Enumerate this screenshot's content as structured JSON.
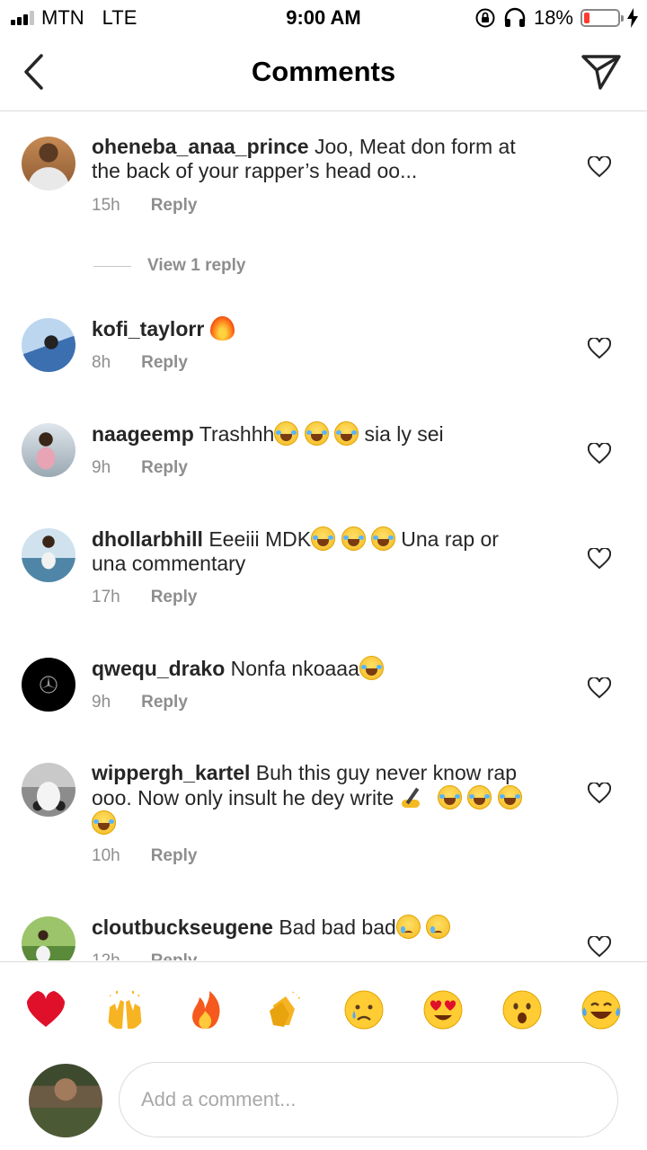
{
  "status_bar": {
    "carrier": "MTN",
    "network": "LTE",
    "time": "9:00 AM",
    "battery": "18%",
    "battery_level": 0.18
  },
  "header": {
    "title": "Comments",
    "back_icon": "chevron-left-icon",
    "send_icon": "paper-plane-icon"
  },
  "comments": [
    {
      "username": "oheneba_anaa_prince",
      "text_lines": [
        "Joo, Meat don form at",
        "the back of your rapper’s head oo..."
      ],
      "time": "15h",
      "reply_label": "Reply",
      "view_replies": "View 1 reply"
    },
    {
      "username": "kofi_taylorr",
      "text": "",
      "time": "8h",
      "reply_label": "Reply"
    },
    {
      "username": "naageemp",
      "text_a": "Trashhh",
      "text_b": "sia ly sei",
      "time": "9h",
      "reply_label": "Reply"
    },
    {
      "username": "dhollarbhill",
      "text_a": "Eeeiii MDK",
      "text_b": "Una rap or",
      "text_c": "una commentary",
      "time": "17h",
      "reply_label": "Reply"
    },
    {
      "username": "qwequ_drako",
      "text_a": "Nonfa nkoaaa",
      "time": "9h",
      "reply_label": "Reply"
    },
    {
      "username": "wippergh_kartel",
      "text_a": "Buh this guy never know rap",
      "text_b": "ooo. Now only insult he dey write",
      "time": "10h",
      "reply_label": "Reply"
    },
    {
      "username": "cloutbuckseugene",
      "text_a": "Bad bad bad",
      "time": "12h",
      "reply_label": "Reply"
    }
  ],
  "reactions": [
    "red-heart",
    "raising-hands",
    "fire",
    "clapping-hands",
    "crying-face",
    "heart-eyes-face",
    "surprised-face",
    "tears-of-joy-face"
  ],
  "input": {
    "placeholder": "Add a comment..."
  },
  "colors": {
    "text": "#262626",
    "secondary": "#8e8e8e",
    "divider": "#dbdbdb",
    "battery_low": "#ff3b30"
  }
}
